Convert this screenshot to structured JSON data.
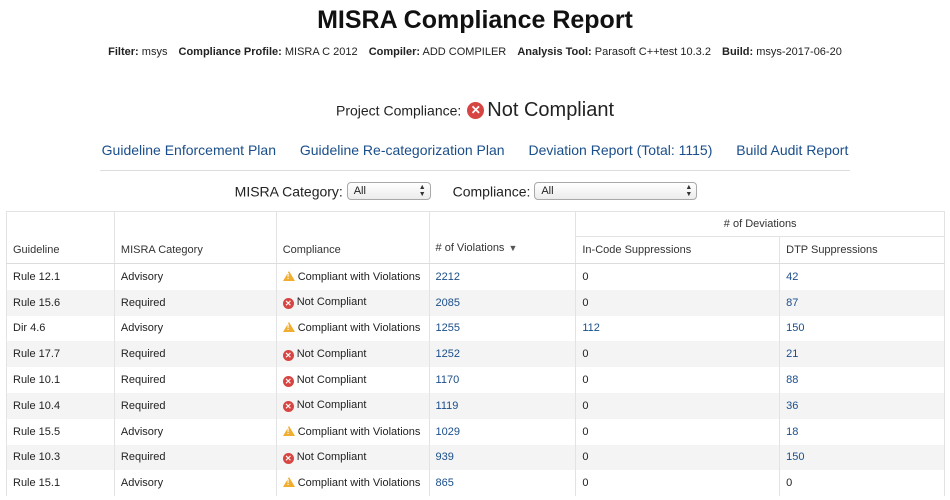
{
  "header": {
    "title": "MISRA Compliance Report",
    "meta": [
      {
        "key": "Filter:",
        "value": "msys"
      },
      {
        "key": "Compliance Profile:",
        "value": "MISRA C 2012"
      },
      {
        "key": "Compiler:",
        "value": "ADD COMPILER"
      },
      {
        "key": "Analysis Tool:",
        "value": "Parasoft C++test 10.3.2"
      },
      {
        "key": "Build:",
        "value": "msys-2017-06-20"
      }
    ]
  },
  "project_compliance": {
    "label": "Project Compliance:",
    "status": "Not Compliant",
    "status_icon": "error-circle-icon",
    "status_color": "#d64541"
  },
  "links": {
    "guideline_enforcement": "Guideline Enforcement Plan",
    "recategorization": "Guideline Re-categorization Plan",
    "deviation_report": "Deviation Report (Total: 1115)",
    "build_audit": "Build Audit Report"
  },
  "filters": {
    "category_label": "MISRA Category:",
    "category_value": "All",
    "compliance_label": "Compliance:",
    "compliance_value": "All"
  },
  "table": {
    "group_header": "# of Deviations",
    "columns": {
      "guideline": "Guideline",
      "category": "MISRA Category",
      "compliance": "Compliance",
      "violations": "# of Violations",
      "incode": "In-Code Suppressions",
      "dtp": "DTP Suppressions"
    },
    "sort_icon": "sort-desc-icon",
    "rows": [
      {
        "guideline": "Rule 12.1",
        "category": "Advisory",
        "compliance": "Compliant with Violations",
        "status": "warn",
        "violations": "2212",
        "incode": "0",
        "dtp": "42"
      },
      {
        "guideline": "Rule 15.6",
        "category": "Required",
        "compliance": "Not Compliant",
        "status": "error",
        "violations": "2085",
        "incode": "0",
        "dtp": "87"
      },
      {
        "guideline": "Dir 4.6",
        "category": "Advisory",
        "compliance": "Compliant with Violations",
        "status": "warn",
        "violations": "1255",
        "incode": "112",
        "dtp": "150"
      },
      {
        "guideline": "Rule 17.7",
        "category": "Required",
        "compliance": "Not Compliant",
        "status": "error",
        "violations": "1252",
        "incode": "0",
        "dtp": "21"
      },
      {
        "guideline": "Rule 10.1",
        "category": "Required",
        "compliance": "Not Compliant",
        "status": "error",
        "violations": "1170",
        "incode": "0",
        "dtp": "88"
      },
      {
        "guideline": "Rule 10.4",
        "category": "Required",
        "compliance": "Not Compliant",
        "status": "error",
        "violations": "1119",
        "incode": "0",
        "dtp": "36"
      },
      {
        "guideline": "Rule 15.5",
        "category": "Advisory",
        "compliance": "Compliant with Violations",
        "status": "warn",
        "violations": "1029",
        "incode": "0",
        "dtp": "18"
      },
      {
        "guideline": "Rule 10.3",
        "category": "Required",
        "compliance": "Not Compliant",
        "status": "error",
        "violations": "939",
        "incode": "0",
        "dtp": "150"
      },
      {
        "guideline": "Rule 15.1",
        "category": "Advisory",
        "compliance": "Compliant with Violations",
        "status": "warn",
        "violations": "865",
        "incode": "0",
        "dtp": "0"
      }
    ]
  },
  "colors": {
    "link": "#1a4e8a",
    "error": "#d64541",
    "warning": "#f0ad2e"
  }
}
